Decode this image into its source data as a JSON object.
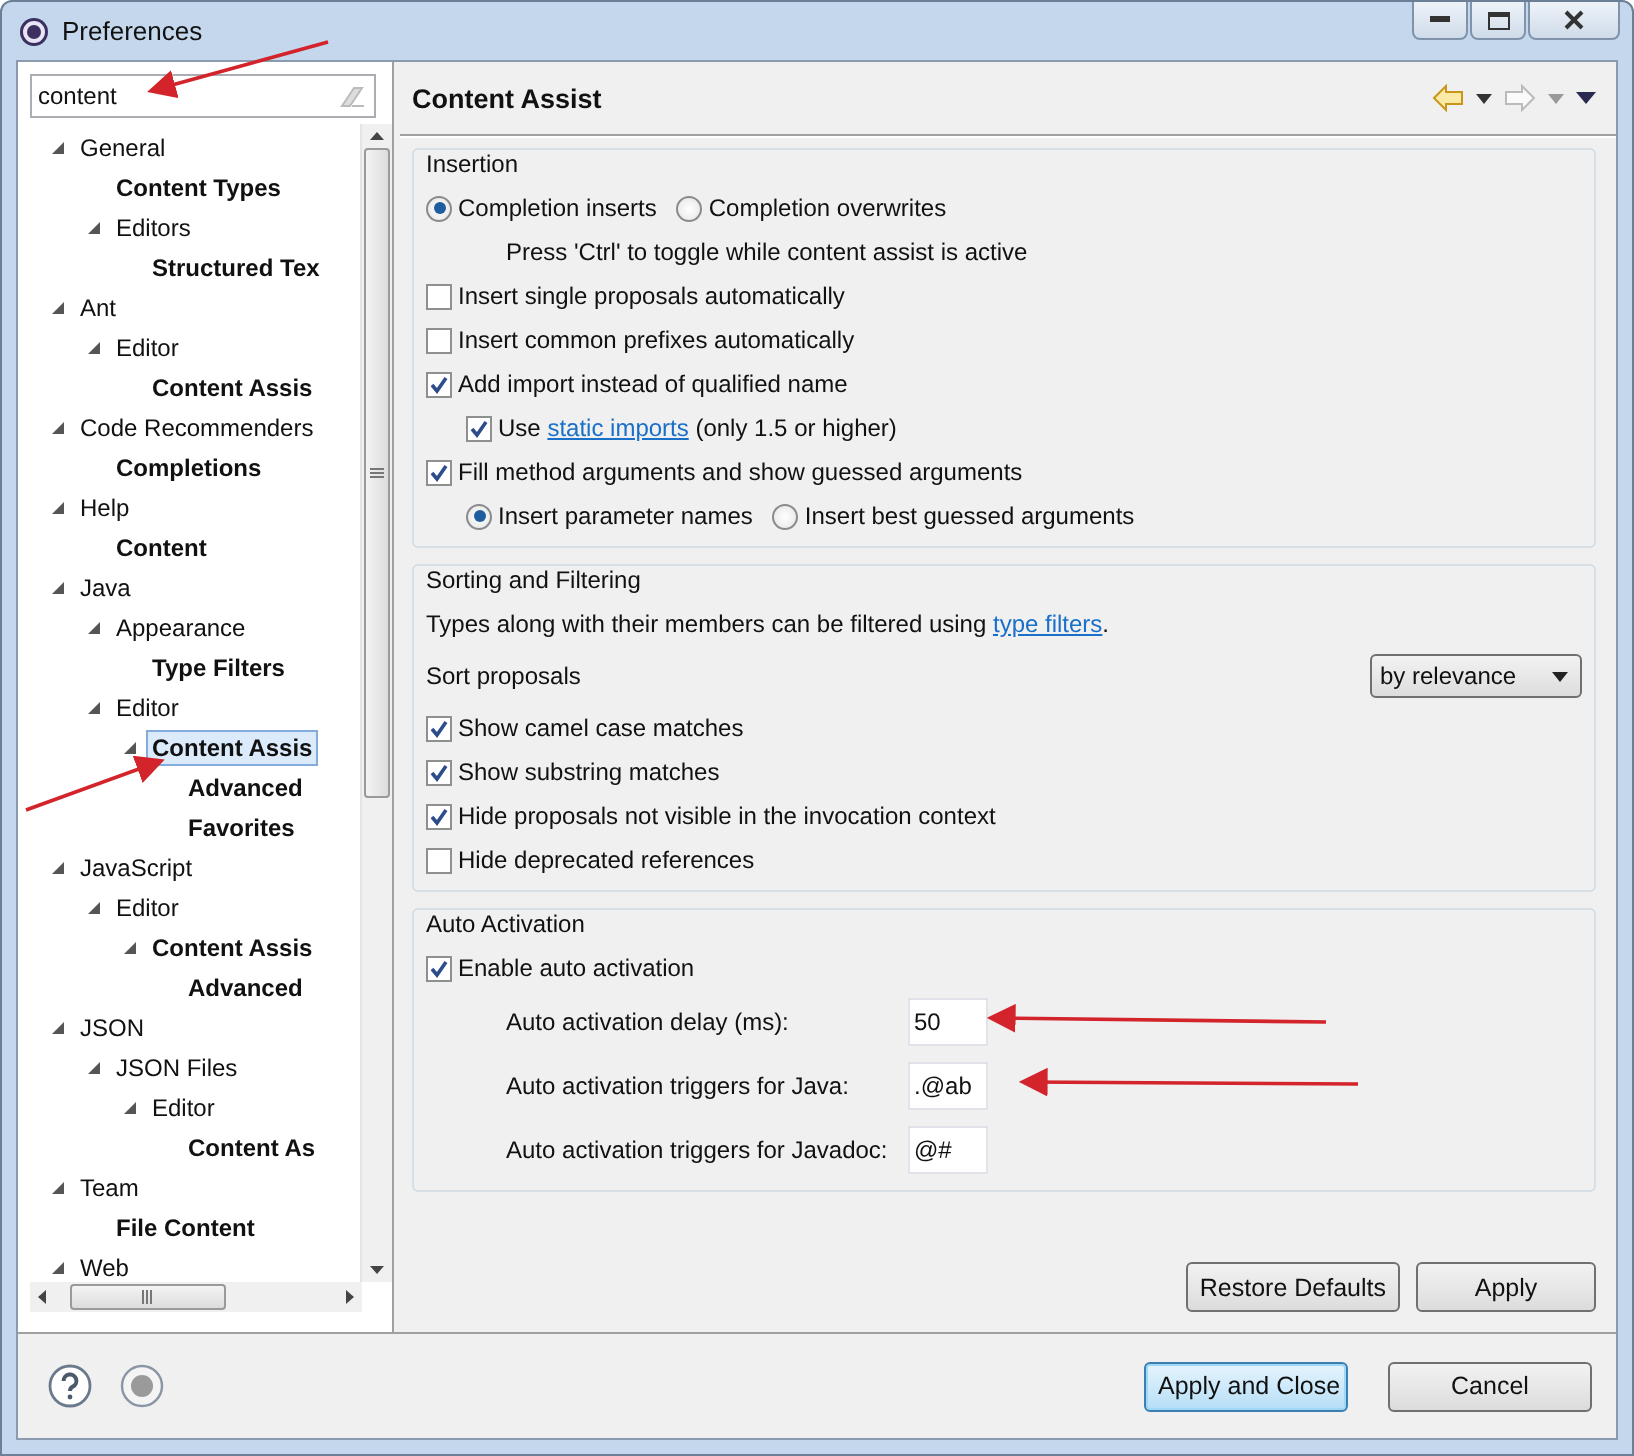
{
  "window": {
    "title": "Preferences"
  },
  "filter": {
    "value": "content"
  },
  "tree": [
    {
      "label": "General",
      "match": false,
      "selected": false,
      "expanded": true,
      "children": [
        {
          "label": "Content Types",
          "match": true,
          "selected": false
        },
        {
          "label": "Editors",
          "match": false,
          "selected": false,
          "expanded": true,
          "children": [
            {
              "label": "Structured Tex",
              "match": true,
              "selected": false
            }
          ]
        }
      ]
    },
    {
      "label": "Ant",
      "match": false,
      "selected": false,
      "expanded": true,
      "children": [
        {
          "label": "Editor",
          "match": false,
          "selected": false,
          "expanded": true,
          "children": [
            {
              "label": "Content Assis",
              "match": true,
              "selected": false
            }
          ]
        }
      ]
    },
    {
      "label": "Code Recommenders",
      "match": false,
      "selected": false,
      "expanded": true,
      "children": [
        {
          "label": "Completions",
          "match": true,
          "selected": false
        }
      ]
    },
    {
      "label": "Help",
      "match": false,
      "selected": false,
      "expanded": true,
      "children": [
        {
          "label": "Content",
          "match": true,
          "selected": false
        }
      ]
    },
    {
      "label": "Java",
      "match": false,
      "selected": false,
      "expanded": true,
      "children": [
        {
          "label": "Appearance",
          "match": false,
          "selected": false,
          "expanded": true,
          "children": [
            {
              "label": "Type Filters",
              "match": true,
              "selected": false
            }
          ]
        },
        {
          "label": "Editor",
          "match": false,
          "selected": false,
          "expanded": true,
          "children": [
            {
              "label": "Content Assis",
              "match": true,
              "selected": true,
              "expanded": true,
              "children": [
                {
                  "label": "Advanced",
                  "match": true,
                  "selected": false
                },
                {
                  "label": "Favorites",
                  "match": true,
                  "selected": false
                }
              ]
            }
          ]
        }
      ]
    },
    {
      "label": "JavaScript",
      "match": false,
      "selected": false,
      "expanded": true,
      "children": [
        {
          "label": "Editor",
          "match": false,
          "selected": false,
          "expanded": true,
          "children": [
            {
              "label": "Content Assis",
              "match": true,
              "selected": false,
              "expanded": true,
              "children": [
                {
                  "label": "Advanced",
                  "match": true,
                  "selected": false
                }
              ]
            }
          ]
        }
      ]
    },
    {
      "label": "JSON",
      "match": false,
      "selected": false,
      "expanded": true,
      "children": [
        {
          "label": "JSON Files",
          "match": false,
          "selected": false,
          "expanded": true,
          "children": [
            {
              "label": "Editor",
              "match": false,
              "selected": false,
              "expanded": true,
              "children": [
                {
                  "label": "Content As",
                  "match": true,
                  "selected": false
                }
              ]
            }
          ]
        }
      ]
    },
    {
      "label": "Team",
      "match": false,
      "selected": false,
      "expanded": true,
      "children": [
        {
          "label": "File Content",
          "match": true,
          "selected": false
        }
      ]
    },
    {
      "label": "Web",
      "match": false,
      "selected": false,
      "expanded": true
    }
  ],
  "page": {
    "title": "Content Assist",
    "groups": [
      {
        "title": "Insertion",
        "rows": [
          {
            "kind": "radios",
            "options": [
              {
                "label": "Completion inserts",
                "selected": true
              },
              {
                "label": "Completion overwrites",
                "selected": false
              }
            ],
            "children": [
              {
                "kind": "note",
                "parts": [
                  {
                    "text": "Press 'Ctrl' to toggle while content assist is active"
                  }
                ]
              }
            ]
          },
          {
            "kind": "checkbox",
            "parts": [
              {
                "text": "Insert single proposals automatically"
              }
            ],
            "checked": false
          },
          {
            "kind": "checkbox",
            "parts": [
              {
                "text": "Insert common prefixes automatically"
              }
            ],
            "checked": false
          },
          {
            "kind": "checkbox",
            "parts": [
              {
                "text": "Add import instead of qualified name"
              }
            ],
            "checked": true,
            "children": [
              {
                "kind": "checkbox",
                "parts": [
                  {
                    "text": "Use "
                  },
                  {
                    "text": "static imports",
                    "kind": "link"
                  },
                  {
                    "text": " (only 1.5 or higher)"
                  }
                ],
                "checked": true
              }
            ]
          },
          {
            "kind": "checkbox",
            "parts": [
              {
                "text": "Fill method arguments and show guessed arguments"
              }
            ],
            "checked": true,
            "children": [
              {
                "kind": "radios",
                "options": [
                  {
                    "label": "Insert parameter names",
                    "selected": true
                  },
                  {
                    "label": "Insert best guessed arguments",
                    "selected": false
                  }
                ]
              }
            ]
          }
        ]
      },
      {
        "title": "Sorting and Filtering",
        "rows": [
          {
            "kind": "note",
            "parts": [
              {
                "text": "Types along with their members can be filtered using "
              },
              {
                "text": "type filters",
                "kind": "link"
              },
              {
                "text": "."
              }
            ]
          },
          {
            "kind": "select",
            "label": "Sort proposals",
            "value": "by relevance"
          },
          {
            "kind": "checkbox",
            "parts": [
              {
                "text": "Show camel case matches"
              }
            ],
            "checked": true
          },
          {
            "kind": "checkbox",
            "parts": [
              {
                "text": "Show substring matches"
              }
            ],
            "checked": true
          },
          {
            "kind": "checkbox",
            "parts": [
              {
                "text": "Hide proposals not visible in the invocation context"
              }
            ],
            "checked": true
          },
          {
            "kind": "checkbox",
            "parts": [
              {
                "text": "Hide deprecated references"
              }
            ],
            "checked": false
          }
        ]
      },
      {
        "title": "Auto Activation",
        "rows": [
          {
            "kind": "checkbox",
            "parts": [
              {
                "text": "Enable auto activation"
              }
            ],
            "checked": true,
            "children": [
              {
                "kind": "field",
                "label": "Auto activation delay (ms):",
                "value": "50"
              },
              {
                "kind": "field",
                "label": "Auto activation triggers for Java:",
                "value": ".@ab"
              },
              {
                "kind": "field",
                "label": "Auto activation triggers for Javadoc:",
                "value": "@#"
              }
            ]
          }
        ]
      }
    ],
    "buttons": [
      {
        "label": "Restore Defaults"
      },
      {
        "label": "Apply"
      }
    ]
  },
  "footer_buttons": [
    {
      "label": "Apply and Close",
      "default": true
    },
    {
      "label": "Cancel",
      "default": false
    }
  ]
}
